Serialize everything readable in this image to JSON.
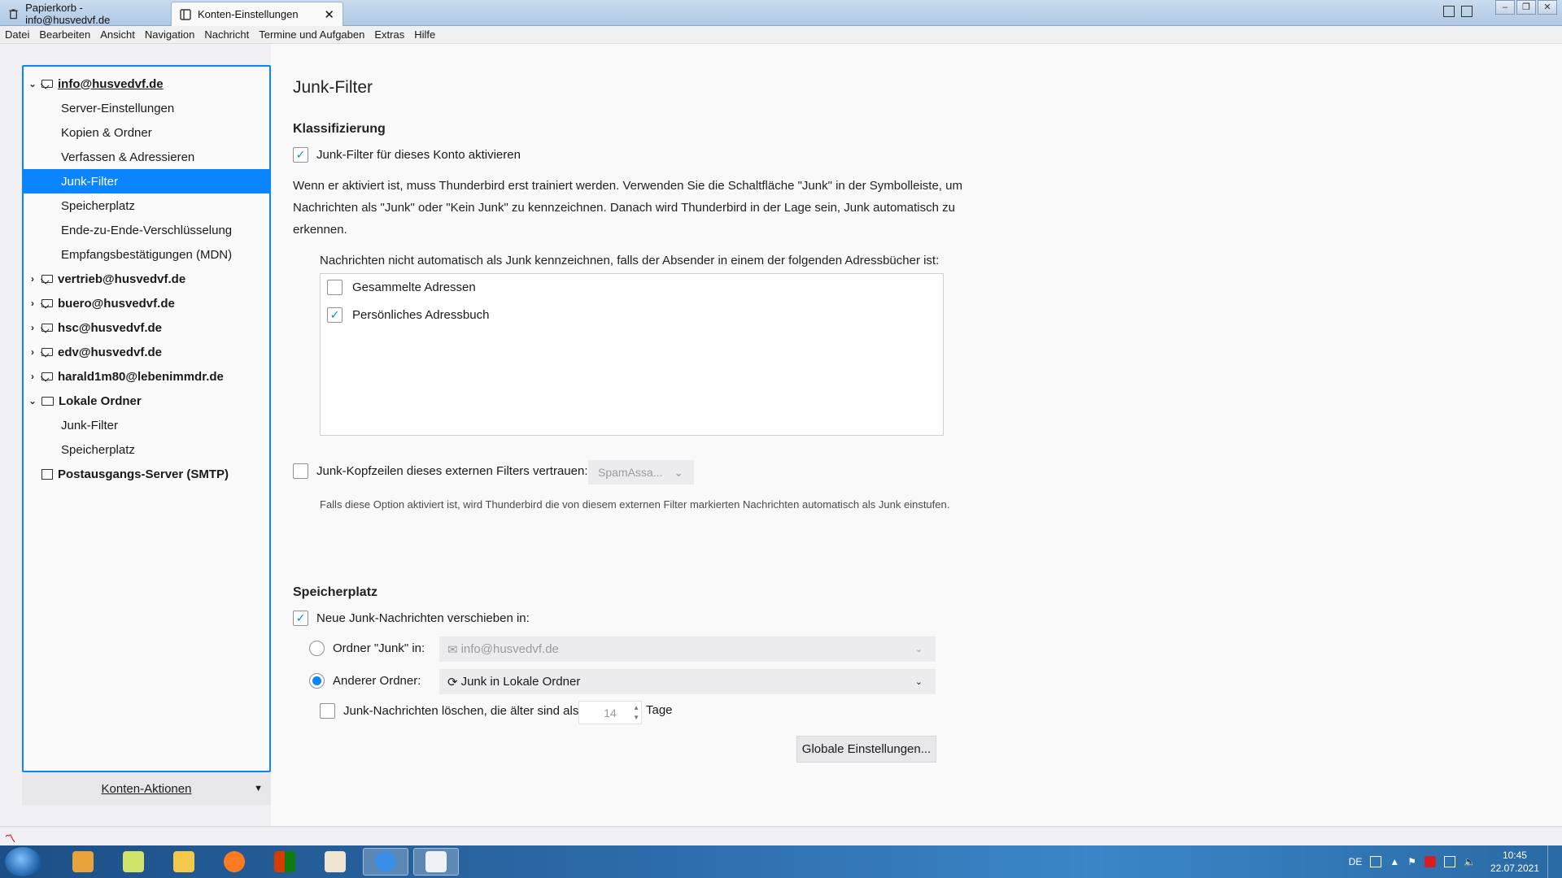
{
  "tabs": [
    {
      "label": "Papierkorb - info@husvedvf.de",
      "icon": "trash-icon"
    },
    {
      "label": "Konten-Einstellungen",
      "icon": "settings-page-icon",
      "close": "✕"
    }
  ],
  "menu": [
    "Datei",
    "Bearbeiten",
    "Ansicht",
    "Navigation",
    "Nachricht",
    "Termine und Aufgaben",
    "Extras",
    "Hilfe"
  ],
  "sidebar": {
    "accounts": [
      {
        "label": "info@husvedvf.de",
        "expanded": true,
        "twisty": "⌄",
        "children": [
          "Server-Einstellungen",
          "Kopien & Ordner",
          "Verfassen & Adressieren",
          "Junk-Filter",
          "Speicherplatz",
          "Ende-zu-Ende-Verschlüsselung",
          "Empfangsbestätigungen (MDN)"
        ]
      },
      {
        "label": "vertrieb@husvedvf.de",
        "twisty": "›"
      },
      {
        "label": "buero@husvedvf.de",
        "twisty": "›"
      },
      {
        "label": "hsc@husvedvf.de",
        "twisty": "›"
      },
      {
        "label": "edv@husvedvf.de",
        "twisty": "›"
      },
      {
        "label": "harald1m80@lebenimmdr.de",
        "twisty": "›"
      },
      {
        "label": "Lokale Ordner",
        "twisty": "⌄",
        "children": [
          "Junk-Filter",
          "Speicherplatz"
        ]
      },
      {
        "label": "Postausgangs-Server (SMTP)"
      }
    ],
    "selected": "Junk-Filter",
    "actions_label": "Konten-Aktionen"
  },
  "main": {
    "title": "Junk-Filter",
    "classification": {
      "heading": "Klassifizierung",
      "enable_label": "Junk-Filter für dieses Konto aktivieren",
      "enable_checked": true,
      "description": "Wenn er aktiviert ist, muss Thunderbird erst trainiert werden. Verwenden Sie die Schaltfläche \"Junk\" in der Symbolleiste, um Nachrichten als \"Junk\" oder \"Kein Junk\" zu kennzeichnen. Danach wird Thunderbird in der Lage sein, Junk automatisch zu erkennen.",
      "whitelist_caption": "Nachrichten nicht automatisch als Junk kennzeichnen, falls der Absender in einem der folgenden Adressbücher ist:",
      "address_books": [
        {
          "label": "Gesammelte Adressen",
          "checked": false
        },
        {
          "label": "Persönliches Adressbuch",
          "checked": true
        }
      ],
      "trust_headers_label": "Junk-Kopfzeilen dieses externen Filters vertrauen:",
      "trust_headers_checked": false,
      "filter_select": "SpamAssa...",
      "trust_note": "Falls diese Option aktiviert ist, wird Thunderbird die von diesem externen Filter markierten Nachrichten automatisch als Junk einstufen."
    },
    "storage": {
      "heading": "Speicherplatz",
      "move_label": "Neue Junk-Nachrichten verschieben in:",
      "move_checked": true,
      "junk_folder_label": "Ordner \"Junk\" in:",
      "junk_folder_value": "info@husvedvf.de",
      "other_folder_label": "Anderer Ordner:",
      "other_folder_value": "Junk in Lokale Ordner",
      "selected_option": "other",
      "delete_label": "Junk-Nachrichten löschen, die älter sind als",
      "delete_checked": false,
      "delete_days": "14",
      "days_unit": "Tage",
      "global_button": "Globale Einstellungen..."
    }
  },
  "taskbar": {
    "apps": [
      "media-player-icon",
      "file-manager-icon",
      "folder-icon",
      "firefox-icon",
      "office-icon",
      "checklist-icon",
      "thunderbird-icon",
      "calendar-app-icon"
    ],
    "language": "DE",
    "time": "10:45",
    "date": "22.07.2021"
  },
  "colors": {
    "accent": "#0a84ff",
    "taskbar": "#2c6aa8"
  }
}
